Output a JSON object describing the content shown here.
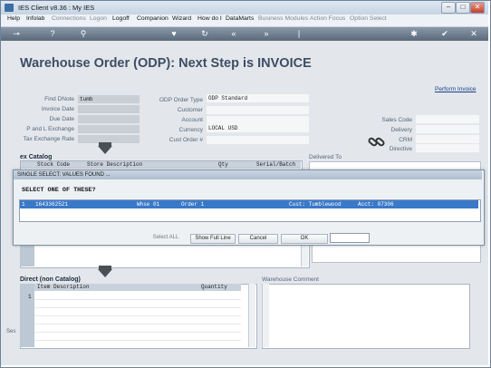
{
  "window": {
    "title": "IES Client v8.36 : My IES"
  },
  "menubar": {
    "items": [
      {
        "label": "Help",
        "dim": false
      },
      {
        "label": "Infolab",
        "dim": false
      },
      {
        "label": "Connections",
        "dim": true
      },
      {
        "label": "Logon",
        "dim": true
      },
      {
        "label": "Logoff",
        "dim": false
      },
      {
        "label": "Companion",
        "dim": false
      },
      {
        "label": "Wizard",
        "dim": false
      },
      {
        "label": "How do I",
        "dim": false
      },
      {
        "label": "DataMarts",
        "dim": false
      },
      {
        "label": "Business Modules",
        "dim": true
      },
      {
        "label": "Action Focus",
        "dim": true
      },
      {
        "label": "Option Select",
        "dim": true
      }
    ]
  },
  "toolbar": {
    "icons": [
      "key-icon",
      "help-icon",
      "search-icon",
      "heart-icon",
      "refresh-icon",
      "rewind-icon",
      "fast-forward-icon",
      "pipe-icon",
      "gear-icon",
      "check-icon",
      "close-icon"
    ],
    "glyphs": [
      "⊸",
      "?",
      "⚲",
      "♥",
      "↻",
      "«",
      "»",
      "|",
      "✱",
      "✔",
      "✕"
    ]
  },
  "page": {
    "heading": "Warehouse Order (ODP): Next Step is INVOICE",
    "perform_link": "Perform Invoice"
  },
  "form": {
    "find_dnote_label": "Find DNote",
    "find_dnote_value": "tumb",
    "invoice_date_label": "Invoice Date",
    "due_date_label": "Due Date",
    "pl_exchange_label": "P and L Exchange",
    "tax_exchange_label": "Tax Exchange Rate",
    "odp_order_type_label": "ODP Order Type",
    "odp_order_type_value": "ODP Standard",
    "customer_label": "Customer",
    "account_label": "Account",
    "currency_label": "Currency",
    "currency_value": "LOCAL USD",
    "cust_order_label": "Cust Order #",
    "sales_code_label": "Sales Code",
    "delivery_label": "Delivery",
    "crm_label": "CRM",
    "directive_label": "Directive"
  },
  "catalog": {
    "title": "ex Catalog",
    "columns": [
      "Stock Code",
      "Store Description",
      "Qty",
      "Serial/Batch"
    ],
    "delivered_to_label": "Delivered To"
  },
  "direct": {
    "title": "Direct (non Catalog)",
    "columns": [
      "Item Description",
      "Quantity"
    ],
    "row_number": "1",
    "warehouse_comment_label": "Warehouse Comment"
  },
  "side_label": "Ses",
  "modal": {
    "title": "SINGLE SELECT: VALUES FOUND ...",
    "prompt": "SELECT ONE OF THESE?",
    "selected_row": {
      "index": "1",
      "code": "1643362521",
      "whse": "Whse 01",
      "order": "Order 1",
      "cust": "Cust: Tumblewood",
      "acct": "Acct: 07306"
    },
    "buttons": {
      "select_all": "Select ALL",
      "show_full_line": "Show Full Line",
      "cancel": "Cancel",
      "ok": "OK"
    }
  }
}
